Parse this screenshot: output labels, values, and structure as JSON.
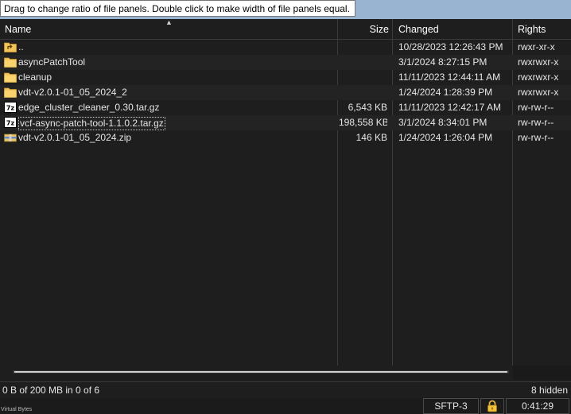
{
  "tooltip": "Drag to change ratio of file panels. Double click to make width of file panels equal.",
  "columns": {
    "name": "Name",
    "size": "Size",
    "changed": "Changed",
    "rights": "Rights"
  },
  "files": [
    {
      "icon": "parent-dir-icon",
      "name": "..",
      "size": "",
      "changed": "10/28/2023 12:26:43 PM",
      "rights": "rwxr-xr-x"
    },
    {
      "icon": "folder-icon",
      "name": "asyncPatchTool",
      "size": "",
      "changed": "3/1/2024 8:27:15 PM",
      "rights": "rwxrwxr-x"
    },
    {
      "icon": "folder-icon",
      "name": "cleanup",
      "size": "",
      "changed": "11/11/2023 12:44:11 AM",
      "rights": "rwxrwxr-x"
    },
    {
      "icon": "folder-icon",
      "name": "vdt-v2.0.1-01_05_2024_2",
      "size": "",
      "changed": "1/24/2024 1:28:39 PM",
      "rights": "rwxrwxr-x"
    },
    {
      "icon": "7z-archive-icon",
      "name": "edge_cluster_cleaner_0.30.tar.gz",
      "size": "6,543 KB",
      "changed": "11/11/2023 12:42:17 AM",
      "rights": "rw-rw-r--"
    },
    {
      "icon": "7z-archive-icon",
      "name": "vcf-async-patch-tool-1.1.0.2.tar.gz",
      "size": "198,558 KB",
      "changed": "3/1/2024 8:34:01 PM",
      "rights": "rw-rw-r--"
    },
    {
      "icon": "zip-archive-icon",
      "name": "vdt-v2.0.1-01_05_2024.zip",
      "size": "146 KB",
      "changed": "1/24/2024 1:26:04 PM",
      "rights": "rw-rw-r--"
    }
  ],
  "status": {
    "selection": "0 B of 200 MB in 0 of 6",
    "hidden": "8 hidden",
    "protocol": "SFTP-3",
    "elapsed": "0:41:29",
    "tiny_label": "Virtual Bytes"
  },
  "colors": {
    "folder": "#f2c55c",
    "background": "#1e1e1e",
    "accent_strip": "#99b4d1"
  }
}
